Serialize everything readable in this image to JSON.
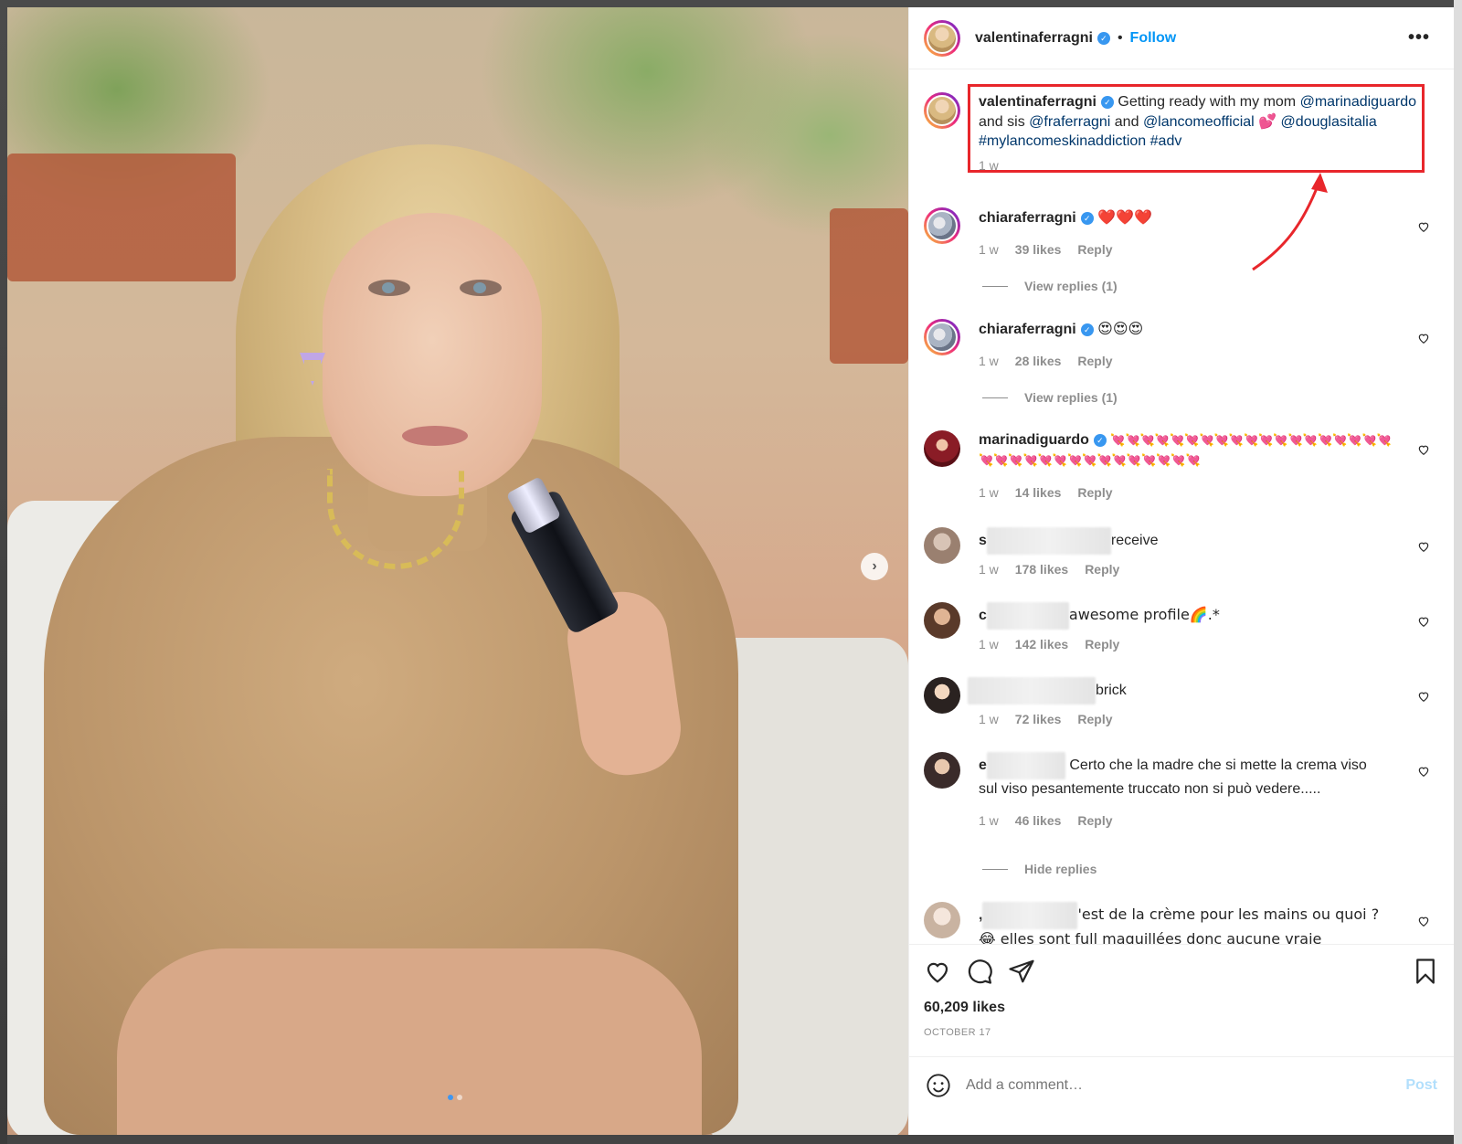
{
  "post": {
    "username": "valentinaferragni",
    "follow_label": "Follow",
    "separator": "•",
    "more_icon": "•••",
    "caption": {
      "username": "valentinaferragni",
      "text_1": "Getting ready with my mom",
      "mention_1": "@marinadiguardo",
      "text_2": "and sis",
      "mention_2": "@fraferragni",
      "text_3": "and",
      "mention_3": "@lancomeofficial",
      "emoji": "💕",
      "mention_4": "@douglasitalia",
      "hashtag_1": "#mylancomeskinaddiction",
      "hashtag_2": "#adv",
      "time": "1 w"
    },
    "likes": "60,209 likes",
    "date": "OCTOBER 17",
    "add_comment_placeholder": "Add a comment…",
    "post_label": "Post",
    "carousel_next_icon": "›"
  },
  "comments": [
    {
      "username": "chiaraferragni",
      "verified": true,
      "text": "❤️❤️❤️",
      "time": "1 w",
      "likes": "39 likes",
      "reply": "Reply",
      "view_replies": "View replies (1)"
    },
    {
      "username": "chiaraferragni",
      "verified": true,
      "text": "😍😍😍",
      "time": "1 w",
      "likes": "28 likes",
      "reply": "Reply",
      "view_replies": "View replies (1)"
    },
    {
      "username": "marinadiguardo",
      "verified": true,
      "text": "💘💘💘💘💘💘💘💘💘💘💘💘💘💘💘💘💘💘💘💘💘💘💘💘💘💘💘💘💘💘💘💘💘💘",
      "time": "1 w",
      "likes": "14 likes",
      "reply": "Reply"
    },
    {
      "username_prefix": "s",
      "text": "receive",
      "time": "1 w",
      "likes": "178 likes",
      "reply": "Reply"
    },
    {
      "username_prefix": "c",
      "text": "awesome profile🌈.*",
      "time": "1 w",
      "likes": "142 likes",
      "reply": "Reply"
    },
    {
      "text": "brick",
      "time": "1 w",
      "likes": "72 likes",
      "reply": "Reply"
    },
    {
      "username_prefix": "e",
      "text": "Certo che la madre che si mette la crema viso sul viso pesantemente truccato non si può vedere.....",
      "time": "1 w",
      "likes": "46 likes",
      "reply": "Reply",
      "hide_replies": "Hide replies"
    },
    {
      "username_prefix": ",",
      "text": "'est de la crème pour les mains ou quoi ? 😂 elles sont full maquillées donc aucune vraie application"
    }
  ],
  "colors": {
    "link": "#00376b",
    "follow": "#0095f6",
    "verified": "#3897f0",
    "highlight_box": "#e8262b",
    "muted": "#8e8e8e"
  },
  "icons": [
    "more-options-icon",
    "verified-badge-icon",
    "heart-icon",
    "comment-icon",
    "share-icon",
    "save-icon",
    "emoji-icon",
    "carousel-next-icon"
  ]
}
